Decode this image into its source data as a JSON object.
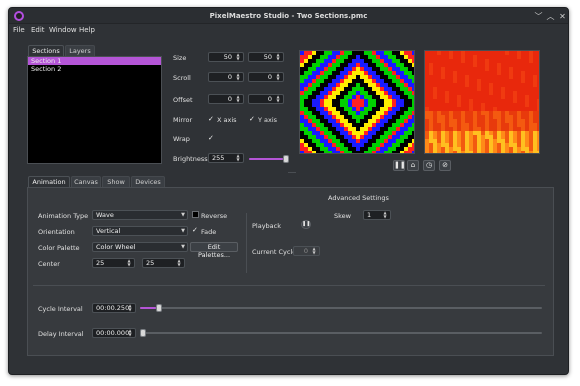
{
  "window": {
    "title": "PixelMaestro Studio - Two Sections.pmc"
  },
  "window_controls": [
    "﹀",
    "︿",
    "✕"
  ],
  "menu": [
    "File",
    "Edit",
    "Window",
    "Help"
  ],
  "left_tabs": [
    "Sections",
    "Layers"
  ],
  "sections": [
    "Section 1",
    "Section 2"
  ],
  "section_controls": {
    "size": {
      "label": "Size",
      "x": "50",
      "y": "50"
    },
    "scroll": {
      "label": "Scroll",
      "x": "0",
      "y": "0"
    },
    "offset": {
      "label": "Offset",
      "x": "0",
      "y": "0"
    },
    "mirror": {
      "label": "Mirror",
      "x_axis": "X axis",
      "y_axis": "Y axis",
      "x_checked": true,
      "y_checked": true
    },
    "wrap": {
      "label": "Wrap",
      "checked": true
    },
    "brightness": {
      "label": "Brightness",
      "value": "255",
      "level": 1.0
    }
  },
  "bottom_tabs": [
    "Animation",
    "Canvas",
    "Show",
    "Devices"
  ],
  "animation": {
    "type_label": "Animation Type",
    "type_value": "Wave",
    "reverse_label": "Reverse",
    "reverse_checked": false,
    "orientation_label": "Orientation",
    "orientation_value": "Vertical",
    "fade_label": "Fade",
    "fade_checked": true,
    "palette_label": "Color Palette",
    "palette_value": "Color Wheel",
    "edit_palettes": "Edit Palettes...",
    "center_label": "Center",
    "center_x": "25",
    "center_y": "25",
    "playback_label": "Playback",
    "current_cycle_label": "Current Cycle",
    "current_cycle_value": "0",
    "advanced_label": "Advanced Settings",
    "skew_label": "Skew",
    "skew_value": "1",
    "cycle_interval_label": "Cycle Interval",
    "cycle_interval_value": "00:00.250",
    "cycle_interval_level": 0.04,
    "delay_interval_label": "Delay Interval",
    "delay_interval_value": "00:00.000",
    "delay_interval_level": 0.0
  },
  "colors": {
    "accent": "#b455d6",
    "window_bg": "#2f3236",
    "list_bg": "#000000"
  }
}
